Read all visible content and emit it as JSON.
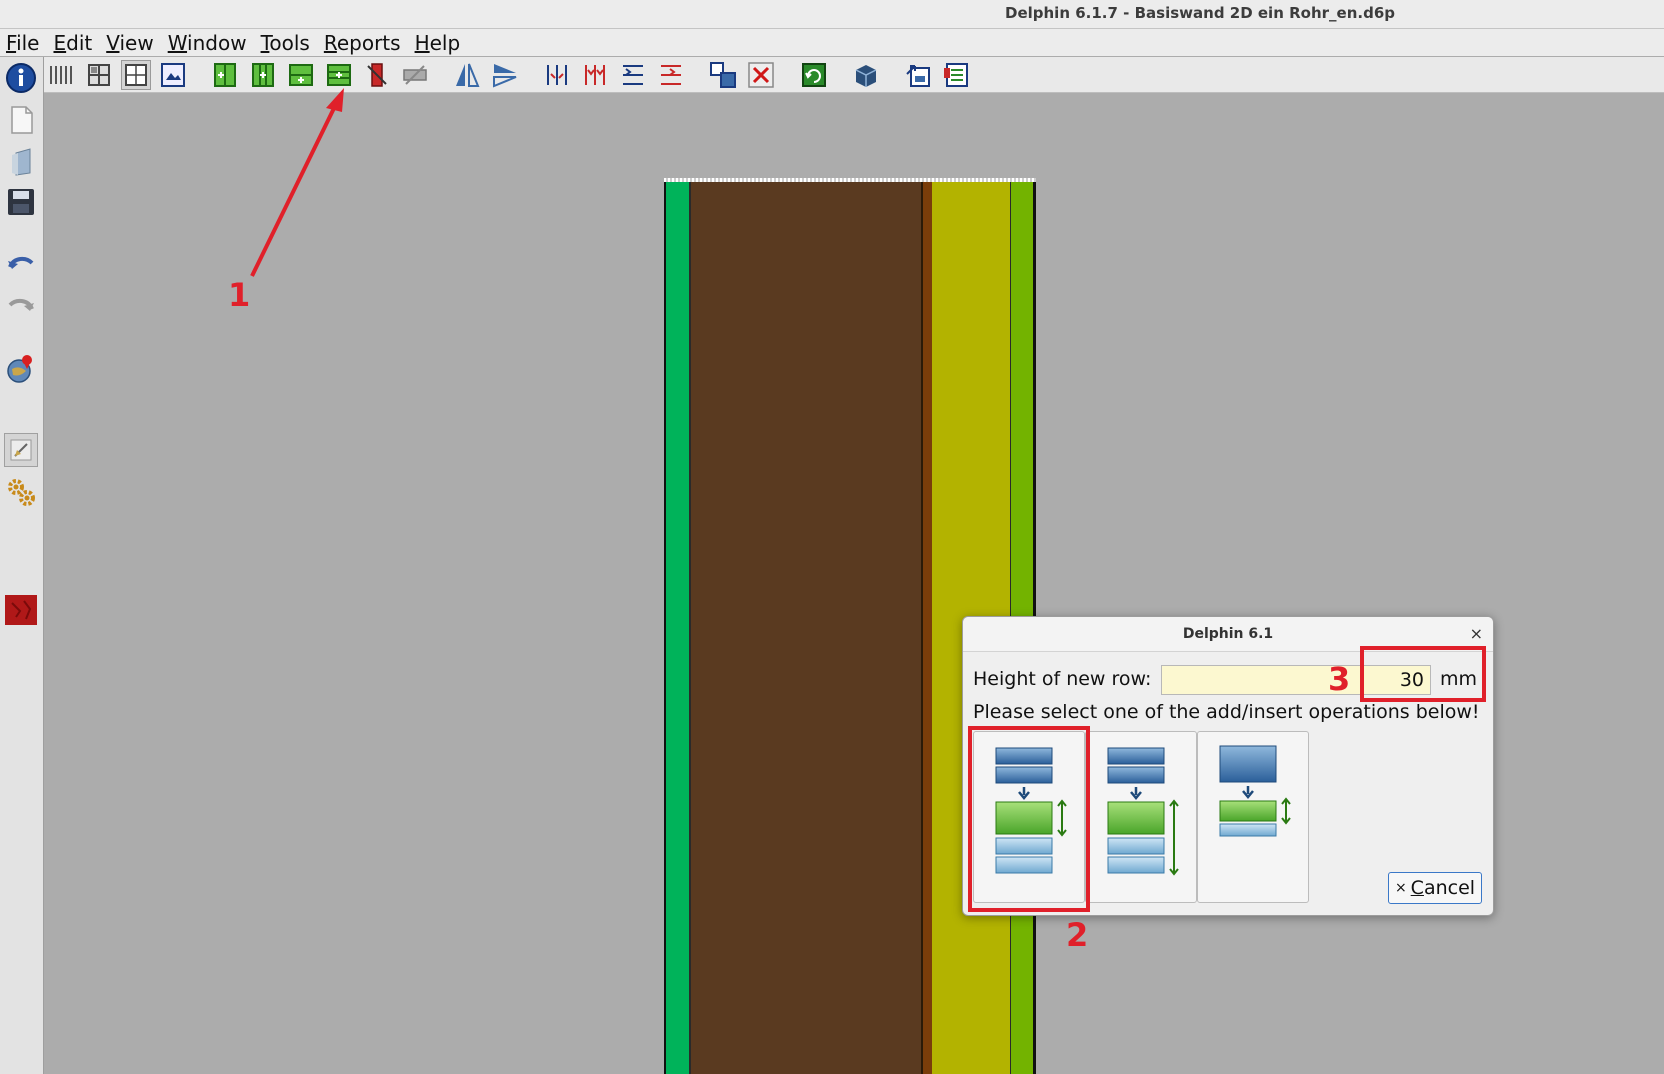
{
  "window": {
    "title": "Delphin 6.1.7 - Basiswand 2D ein Rohr_en.d6p"
  },
  "menu": [
    {
      "pre": "",
      "ul": "F",
      "post": "ile"
    },
    {
      "pre": "",
      "ul": "E",
      "post": "dit"
    },
    {
      "pre": "",
      "ul": "V",
      "post": "iew"
    },
    {
      "pre": "",
      "ul": "W",
      "post": "indow"
    },
    {
      "pre": "",
      "ul": "T",
      "post": "ools"
    },
    {
      "pre": "",
      "ul": "R",
      "post": "eports"
    },
    {
      "pre": "",
      "ul": "H",
      "post": "elp"
    }
  ],
  "toolbar_icons": [
    "vertical-grid-lines-icon",
    "grid-layout-icon",
    "grid-select-icon",
    "image-view-icon",
    "add-column-left-icon",
    "insert-column-icon",
    "add-row-icon",
    "insert-row-icon",
    "delete-column-icon",
    "delete-row-icon",
    "mirror-horizontal-icon",
    "mirror-vertical-icon",
    "split-columns-icon",
    "merge-columns-icon",
    "split-rows-icon",
    "merge-rows-icon",
    "assign-material-icon",
    "remove-material-icon",
    "refresh-grid-icon",
    "3d-rotate-icon",
    "export-icon",
    "import-table-icon"
  ],
  "sidebar_icons": [
    "info-icon",
    "new-file-icon",
    "open-file-icon",
    "save-icon",
    "undo-icon",
    "redo-icon",
    "globe-location-icon",
    "edit-geometry-icon",
    "settings-gears-icon",
    "material-red-icon"
  ],
  "colors": {
    "layer_green": "#00b35a",
    "layer_brown": "#5a3a20",
    "layer_olive": "#b3b300",
    "layer_lime": "#73b300",
    "annotation_red": "#e0202a"
  },
  "dialog": {
    "title": "Delphin 6.1",
    "close_glyph": "×",
    "height_label": "Height of new row:",
    "height_value": "30",
    "unit": "mm",
    "instruction": "Please select one of the add/insert operations below!",
    "cancel": {
      "glyph": "×",
      "ul": "C",
      "post": "ancel"
    }
  },
  "annotations": [
    "1",
    "2",
    "3"
  ]
}
